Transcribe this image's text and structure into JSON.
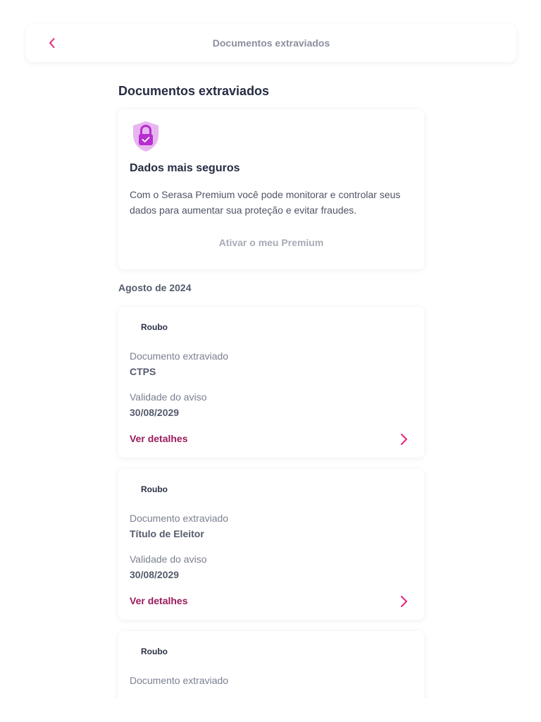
{
  "header": {
    "title": "Documentos extraviados",
    "back_icon": "chevron-left-icon"
  },
  "page": {
    "heading": "Documentos extraviados"
  },
  "promo": {
    "icon": "shield-lock-icon",
    "title": "Dados mais seguros",
    "description": "Com o Serasa Premium você pode monitorar e controlar seus dados para aumentar sua proteção e evitar fraudes.",
    "cta_label": "Ativar o meu Premium"
  },
  "section": {
    "month": "Agosto de 2024"
  },
  "documents": [
    {
      "type": "Roubo",
      "doc_label": "Documento extraviado",
      "doc_value": "CTPS",
      "validity_label": "Validade do aviso",
      "validity_value": "30/08/2029",
      "details_label": "Ver detalhes"
    },
    {
      "type": "Roubo",
      "doc_label": "Documento extraviado",
      "doc_value": "Título de Eleitor",
      "validity_label": "Validade do aviso",
      "validity_value": "30/08/2029",
      "details_label": "Ver detalhes"
    },
    {
      "type": "Roubo",
      "doc_label": "Documento extraviado"
    }
  ],
  "colors": {
    "accent": "#e6247a",
    "link": "#9a1b5b",
    "shield_light": "#e7b6ef",
    "shield_dark": "#b72dd0"
  }
}
